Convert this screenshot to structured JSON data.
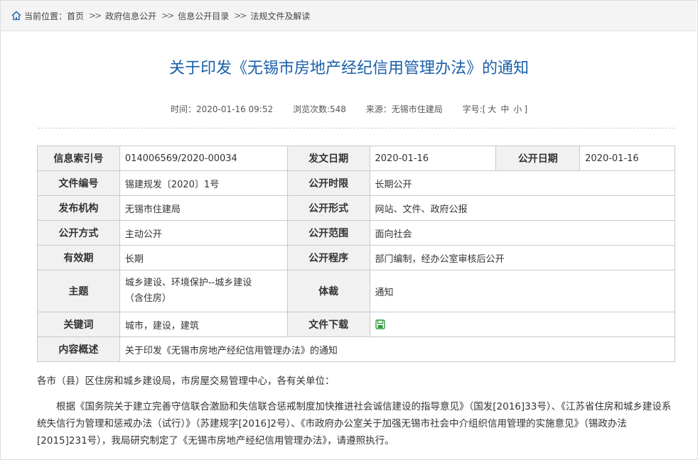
{
  "breadcrumb": {
    "prefix": "当前位置：",
    "items": [
      "首页",
      "政府信息公开",
      "信息公开目录",
      "法规文件及解读"
    ],
    "separator": ">>"
  },
  "title": "关于印发《无锡市房地产经纪信用管理办法》的通知",
  "meta": {
    "time_label": "时间：",
    "time": "2020-01-16 09:52",
    "views_label": "浏览次数:",
    "views": "548",
    "source_label": "来源：",
    "source": "无锡市住建局",
    "fontsize_label": "字号:",
    "fontsize_open": "[",
    "fontsize_large": "大",
    "fontsize_medium": "中",
    "fontsize_small": "小",
    "fontsize_close": "]"
  },
  "info_table": {
    "index_label": "信息索引号",
    "index_value": "014006569/2020-00034",
    "issue_date_label": "发文日期",
    "issue_date_value": "2020-01-16",
    "public_date_label": "公开日期",
    "public_date_value": "2020-01-16",
    "doc_no_label": "文件编号",
    "doc_no_value": "锡建规发〔2020〕1号",
    "time_limit_label": "公开时限",
    "time_limit_value": "长期公开",
    "publisher_label": "发布机构",
    "publisher_value": "无锡市住建局",
    "form_label": "公开形式",
    "form_value": "网站、文件、政府公报",
    "method_label": "公开方式",
    "method_value": "主动公开",
    "scope_label": "公开范围",
    "scope_value": "面向社会",
    "validity_label": "有效期",
    "validity_value": "长期",
    "procedure_label": "公开程序",
    "procedure_value": "部门编制，经办公室审核后公开",
    "topic_label": "主题",
    "topic_value_line1": "城乡建设、环境保护--城乡建设",
    "topic_value_line2": "（含住房）",
    "genre_label": "体裁",
    "genre_value": "通知",
    "keywords_label": "关键词",
    "keywords_value": "城市，建设，建筑",
    "download_label": "文件下载",
    "summary_label": "内容概述",
    "summary_value": "关于印发《无锡市房地产经纪信用管理办法》的通知"
  },
  "body": {
    "salutation": "各市（县）区住房和城乡建设局，市房屋交易管理中心，各有关单位：",
    "paragraph": "根据《国务院关于建立完善守信联合激励和失信联合惩戒制度加快推进社会诚信建设的指导意见》（国发[2016]33号）、《江苏省住房和城乡建设系统失信行为管理和惩戒办法（试行）》（苏建规字[2016]2号）、《市政府办公室关于加强无锡市社会中介组织信用管理的实施意见》（锡政办法[2015]231号），我局研究制定了《无锡市房地产经纪信用管理办法》，请遵照执行。"
  },
  "colors": {
    "title": "#1a5fa8",
    "label_bg": "#f1f1f1",
    "border": "#c9c9c9",
    "download_icon": "#2e9b3a",
    "home_icon": "#2a6fb0"
  },
  "icons": {
    "home": "home-icon",
    "download": "file-download-icon"
  }
}
